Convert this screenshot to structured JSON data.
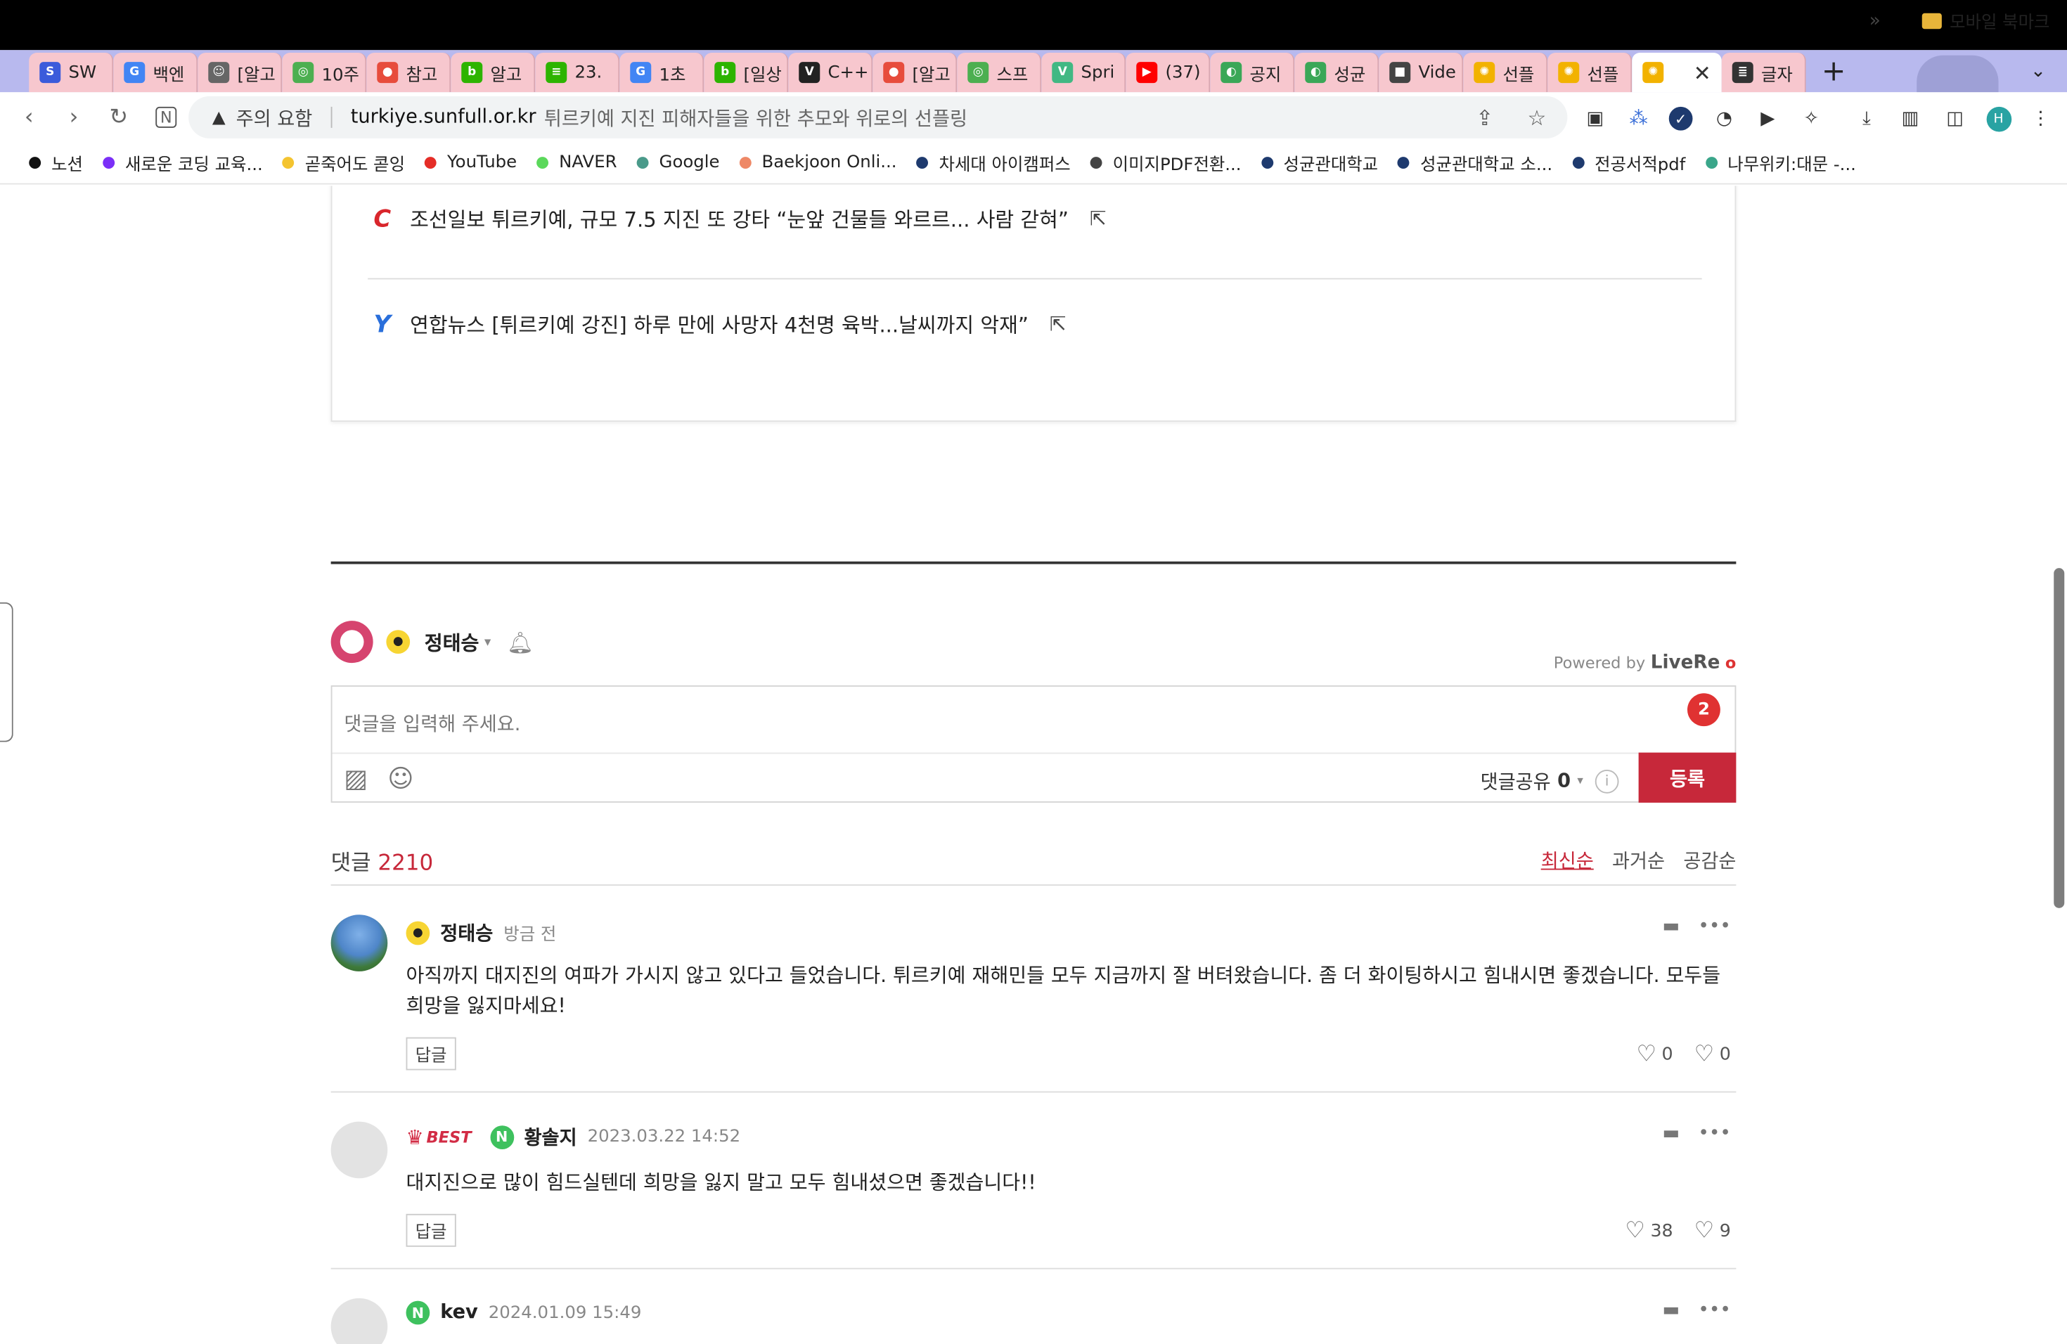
{
  "browser": {
    "tabs": [
      {
        "label": "SW",
        "fav_color": "#3b5bdb",
        "fav_text": "S"
      },
      {
        "label": "백엔",
        "fav_color": "#4285f4",
        "fav_text": "G"
      },
      {
        "label": "[알고",
        "fav_color": "#666666",
        "fav_text": "☺"
      },
      {
        "label": "10주",
        "fav_color": "#4caf50",
        "fav_text": "◎"
      },
      {
        "label": "참고",
        "fav_color": "#e74c3c",
        "fav_text": "●"
      },
      {
        "label": "알고",
        "fav_color": "#2db400",
        "fav_text": "b"
      },
      {
        "label": "23.",
        "fav_color": "#2db400",
        "fav_text": "≡"
      },
      {
        "label": "1초",
        "fav_color": "#4285f4",
        "fav_text": "G"
      },
      {
        "label": "[일상",
        "fav_color": "#2db400",
        "fav_text": "b"
      },
      {
        "label": "C++",
        "fav_color": "#222222",
        "fav_text": "V"
      },
      {
        "label": "[알고",
        "fav_color": "#e74c3c",
        "fav_text": "●"
      },
      {
        "label": "스프",
        "fav_color": "#4caf50",
        "fav_text": "◎"
      },
      {
        "label": "Spri",
        "fav_color": "#41b883",
        "fav_text": "V"
      },
      {
        "label": "(37)",
        "fav_color": "#ff0000",
        "fav_text": "▶"
      },
      {
        "label": "공지",
        "fav_color": "#3aa757",
        "fav_text": "◐"
      },
      {
        "label": "성균",
        "fav_color": "#3aa757",
        "fav_text": "◐"
      },
      {
        "label": "Vide",
        "fav_color": "#444444",
        "fav_text": "■"
      },
      {
        "label": "선플",
        "fav_color": "#f2b200",
        "fav_text": "✺"
      },
      {
        "label": "선플",
        "fav_color": "#f2b200",
        "fav_text": "✺"
      },
      {
        "label": "",
        "fav_color": "#f2b200",
        "fav_text": "✺",
        "active": true
      },
      {
        "label": "글자",
        "fav_color": "#333333",
        "fav_text": "≣"
      }
    ],
    "new_tab": "+",
    "close_tab": "✕",
    "tab_list": "⌄",
    "url_warning": "주의 요함",
    "url_host": "turkiye.sunfull.or.kr",
    "url_title": "튀르키예 지진 피해자들을 위한 추모와 위로의 선플링",
    "profile_initial": "H",
    "bookmarks": [
      {
        "label": "노션",
        "color": "#111111"
      },
      {
        "label": "새로운 코딩 교육...",
        "color": "#7b2ff7"
      },
      {
        "label": "곧죽어도 콛잉",
        "color": "#f4c430"
      },
      {
        "label": "YouTube",
        "color": "#e52d27"
      },
      {
        "label": "NAVER",
        "color": "#5bd85b"
      },
      {
        "label": "Google",
        "color": "#4a9a8a"
      },
      {
        "label": "Baekjoon Onli...",
        "color": "#ee8866"
      },
      {
        "label": "차세대 아이캠퍼스",
        "color": "#1e3a6e"
      },
      {
        "label": "이미지PDF전환...",
        "color": "#444444"
      },
      {
        "label": "성균관대학교",
        "color": "#1e3a6e"
      },
      {
        "label": "성균관대학교 소...",
        "color": "#1e3a6e"
      },
      {
        "label": "전공서적pdf",
        "color": "#1e3a6e"
      },
      {
        "label": "나무위키:대문 -...",
        "color": "#3aa68a"
      }
    ],
    "bookmarks_more": "»",
    "mobile_bookmarks": "모바일 북마크"
  },
  "news": [
    {
      "logo": "C",
      "logo_color": "#d9262c",
      "text": "조선일보 튀르키예, 규모 7.5 지진 또 강타 “눈앞 건물들 와르르... 사람 갇혀”"
    },
    {
      "logo": "Y",
      "logo_color": "#2a6fdb",
      "text": "연합뉴스 [튀르키예 강진] 하루 만에 사망자 4천명 육박...날씨까지 악재”"
    }
  ],
  "comment_box": {
    "user_name": "정태승",
    "powered_by": "Powered by",
    "brand": "LiveRe",
    "placeholder": "댓글을 입력해 주세요.",
    "notif_count": "2",
    "share_label": "댓글공유",
    "share_count": "0",
    "submit": "등록"
  },
  "comments_header": {
    "label": "댓글",
    "count": "2210",
    "sorts": [
      "최신순",
      "과거순",
      "공감순"
    ],
    "active_sort": "최신순"
  },
  "comments": [
    {
      "name": "정태승",
      "time": "방금 전",
      "platform": "kakao",
      "best": false,
      "body": "아직까지 대지진의 여파가 가시지 않고 있다고 들었습니다. 튀르키예 재해민들 모두 지금까지 잘 버텨왔습니다. 좀 더 화이팅하시고 힘내시면 좋겠습니다. 모두들 희망을 잃지마세요!",
      "reply": "답글",
      "likes": "0",
      "dislikes": "0"
    },
    {
      "name": "황솔지",
      "time": "2023.03.22 14:52",
      "platform": "naver",
      "best": true,
      "best_label": "BEST",
      "body": "대지진으로 많이 힘드실텐데 희망을 잃지 말고 모두 힘내셨으면 좋겠습니다!!",
      "reply": "답글",
      "likes": "38",
      "dislikes": "9"
    },
    {
      "name": "kev",
      "time": "2024.01.09 15:49",
      "platform": "naver",
      "best": false
    }
  ]
}
